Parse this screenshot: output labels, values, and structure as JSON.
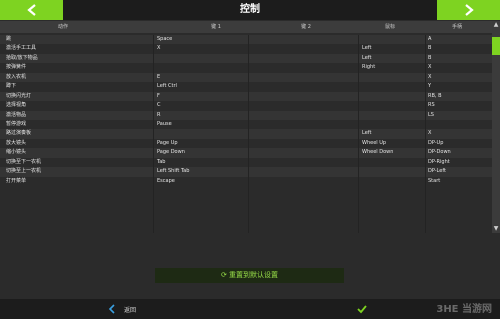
{
  "title": "控制",
  "columns": [
    "动作",
    "键 1",
    "键 2",
    "鼠标",
    "手柄"
  ],
  "rows": [
    [
      "跳",
      "Space",
      "",
      "",
      "A"
    ],
    [
      "激活手工工具",
      "X",
      "",
      "Left",
      "B"
    ],
    [
      "拾取/放下物品",
      "",
      "",
      "Left",
      "B"
    ],
    [
      "按弹簧件",
      "",
      "",
      "Right",
      "X"
    ],
    [
      "放入农机",
      "E",
      "",
      "",
      "X"
    ],
    [
      "蹲下",
      "Left Ctrl",
      "",
      "",
      "Y"
    ],
    [
      "切换闪光灯",
      "F",
      "",
      "",
      "RB, B"
    ],
    [
      "选择视角",
      "C",
      "",
      "",
      "RS"
    ],
    [
      "激活物品",
      "R",
      "",
      "",
      "LS"
    ],
    [
      "暂停游戏",
      "Pause",
      "",
      "",
      ""
    ],
    [
      "路过演奏板",
      "",
      "",
      "Left",
      "X"
    ],
    [
      "放大镜头",
      "Page Up",
      "",
      "Wheel Up",
      "DP-Up"
    ],
    [
      "缩小镜头",
      "Page Down",
      "",
      "Wheel Down",
      "DP-Down"
    ],
    [
      "切换至下一农机",
      "Tab",
      "",
      "",
      "DP-Right"
    ],
    [
      "切换至上一农机",
      "Left Shift Tab",
      "",
      "",
      "DP-Left"
    ],
    [
      "打开菜单",
      "Escape",
      "",
      "",
      "Start"
    ]
  ],
  "reset_label": "重置到默认设置",
  "back_label": "返回",
  "pager": {
    "count": 3,
    "active_index": 1
  },
  "watermark": "3HE 当游网",
  "colors": {
    "accent": "#7ed321"
  }
}
